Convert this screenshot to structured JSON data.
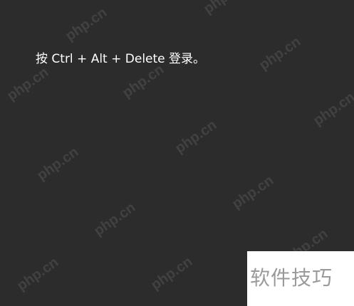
{
  "login_prompt": {
    "text": "按 Ctrl + Alt + Delete 登录。"
  },
  "watermarks": [
    "php.cn",
    "php.cn",
    "php.cn",
    "php.cn",
    "php.cn",
    "php.cn",
    "php.cn",
    "php.cn",
    "php.cn",
    "php.cn",
    "php.cn",
    "php.cn",
    "php.cn",
    "php.cn",
    "php.cn",
    "php.cn"
  ],
  "corner_badge": {
    "text": "软件技巧"
  },
  "colors": {
    "background": "#2c2c2c",
    "prompt_text": "#ffffff",
    "badge_background": "#ffffff",
    "badge_text": "#9a9a9a"
  }
}
